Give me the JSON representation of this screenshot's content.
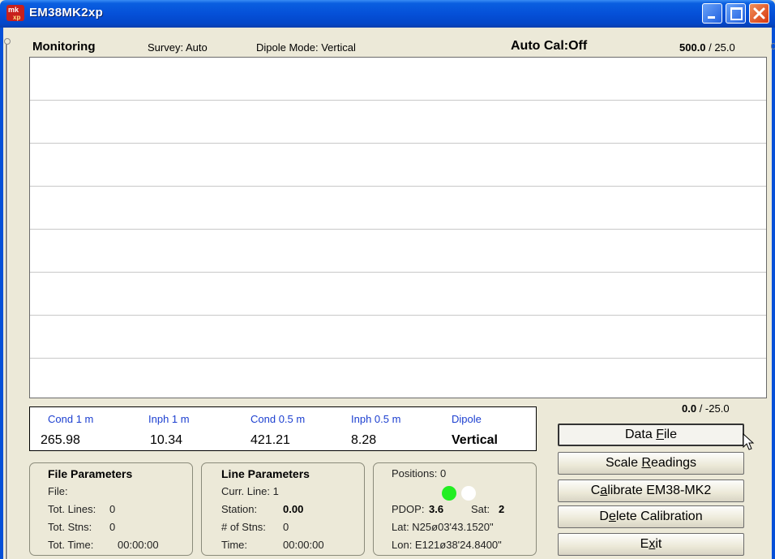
{
  "window": {
    "title": "EM38MK2xp",
    "logo_text": "mk2\nxp"
  },
  "header": {
    "mode": "Monitoring",
    "survey": "Survey: Auto",
    "dipole_mode": "Dipole Mode: Vertical",
    "auto_cal": "Auto Cal:Off",
    "scale_high_bold": "500.0",
    "scale_high_rest": " / 25.0"
  },
  "plot": {
    "gridlines": 7
  },
  "scale_low": {
    "bold": "0.0",
    "rest": " / -25.0"
  },
  "readings": {
    "columns": [
      {
        "label": "Cond 1 m",
        "value": "265.98"
      },
      {
        "label": "Inph 1 m",
        "value": "10.34"
      },
      {
        "label": "Cond 0.5 m",
        "value": "421.21"
      },
      {
        "label": "Inph 0.5 m",
        "value": "8.28"
      },
      {
        "label": "Dipole",
        "value": "Vertical"
      }
    ]
  },
  "file_parameters": {
    "title": "File Parameters",
    "file_label": "File:",
    "tot_lines_label": "Tot. Lines:",
    "tot_lines": "0",
    "tot_stns_label": "Tot. Stns:",
    "tot_stns": "0",
    "tot_time_label": "Tot. Time:",
    "tot_time": "00:00:00"
  },
  "line_parameters": {
    "title": "Line Parameters",
    "curr_line": "Curr. Line: 1",
    "station_label": "Station:",
    "station": "0.00",
    "num_stns_label": "# of Stns:",
    "num_stns": "0",
    "time_label": "Time:",
    "time": "00:00:00"
  },
  "gps": {
    "positions": "Positions: 0",
    "pdop_label": "PDOP:",
    "pdop": "3.6",
    "sat_label": "Sat:",
    "sat": "2",
    "lat": "Lat:  N25ø03'43.1520\"",
    "lon": "Lon: E121ø38'24.8400\"",
    "indicator_colors": [
      "#22ee22",
      "#ffffff"
    ]
  },
  "buttons": {
    "data_file_pre": "Data ",
    "data_file_key": "F",
    "data_file_post": "ile",
    "scale_pre": "Scale ",
    "scale_key": "R",
    "scale_post": "eadings",
    "calibrate_pre": "C",
    "calibrate_key": "a",
    "calibrate_post": "librate EM38-MK2",
    "delete_pre": "D",
    "delete_key": "e",
    "delete_post": "lete Calibration",
    "exit_pre": "E",
    "exit_key": "x",
    "exit_post": "it"
  }
}
